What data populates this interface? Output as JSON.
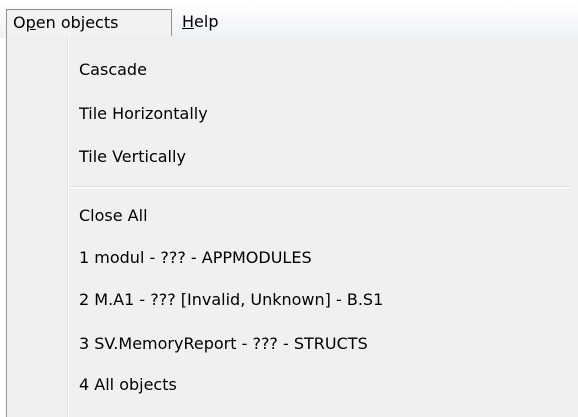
{
  "menubar": {
    "open_objects_label": "Open objects",
    "help_label": "Help"
  },
  "menu": {
    "cascade": "Cascade",
    "tile_horizontally": "Tile Horizontally",
    "tile_vertically": "Tile Vertically",
    "close_all": "Close All",
    "windows": [
      "1 modul - ??? - APPMODULES",
      "2 M.A1 - ??? [Invalid, Unknown] - B.S1",
      "3 SV.MemoryReport - ??? - STRUCTS",
      "4 All objects"
    ]
  }
}
